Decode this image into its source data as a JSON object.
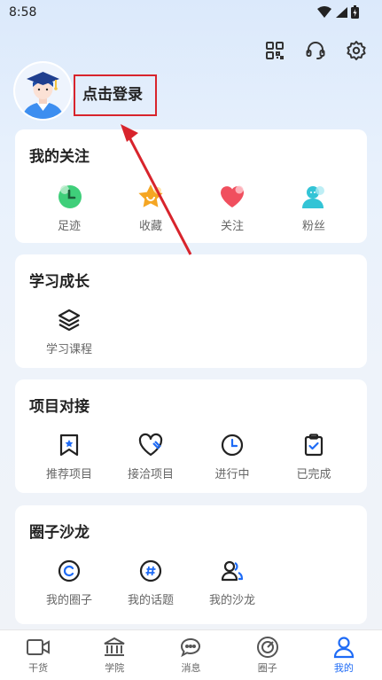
{
  "status": {
    "time": "8:58"
  },
  "header": {
    "login_label": "点击登录"
  },
  "follow": {
    "title": "我的关注",
    "items": [
      {
        "label": "足迹",
        "icon": "clock-icon"
      },
      {
        "label": "收藏",
        "icon": "star-icon"
      },
      {
        "label": "关注",
        "icon": "heart-icon"
      },
      {
        "label": "粉丝",
        "icon": "user-icon"
      }
    ]
  },
  "study": {
    "title": "学习成长",
    "items": [
      {
        "label": "学习课程",
        "icon": "layers-icon"
      }
    ]
  },
  "project": {
    "title": "项目对接",
    "items": [
      {
        "label": "推荐项目",
        "icon": "bookmark-star-icon"
      },
      {
        "label": "接洽项目",
        "icon": "handshake-heart-icon"
      },
      {
        "label": "进行中",
        "icon": "clock-icon"
      },
      {
        "label": "已完成",
        "icon": "clipboard-check-icon"
      }
    ]
  },
  "salon": {
    "title": "圈子沙龙",
    "items": [
      {
        "label": "我的圈子",
        "icon": "circle-icon"
      },
      {
        "label": "我的话题",
        "icon": "hashtag-icon"
      },
      {
        "label": "我的沙龙",
        "icon": "people-icon"
      }
    ]
  },
  "tabs": [
    {
      "label": "干货",
      "icon": "video-icon"
    },
    {
      "label": "学院",
      "icon": "bank-icon"
    },
    {
      "label": "消息",
      "icon": "chat-icon"
    },
    {
      "label": "圈子",
      "icon": "radar-icon"
    },
    {
      "label": "我的",
      "icon": "person-icon",
      "active": true
    }
  ],
  "colors": {
    "accent": "#1e6bf6",
    "annotation": "#d8242c"
  }
}
